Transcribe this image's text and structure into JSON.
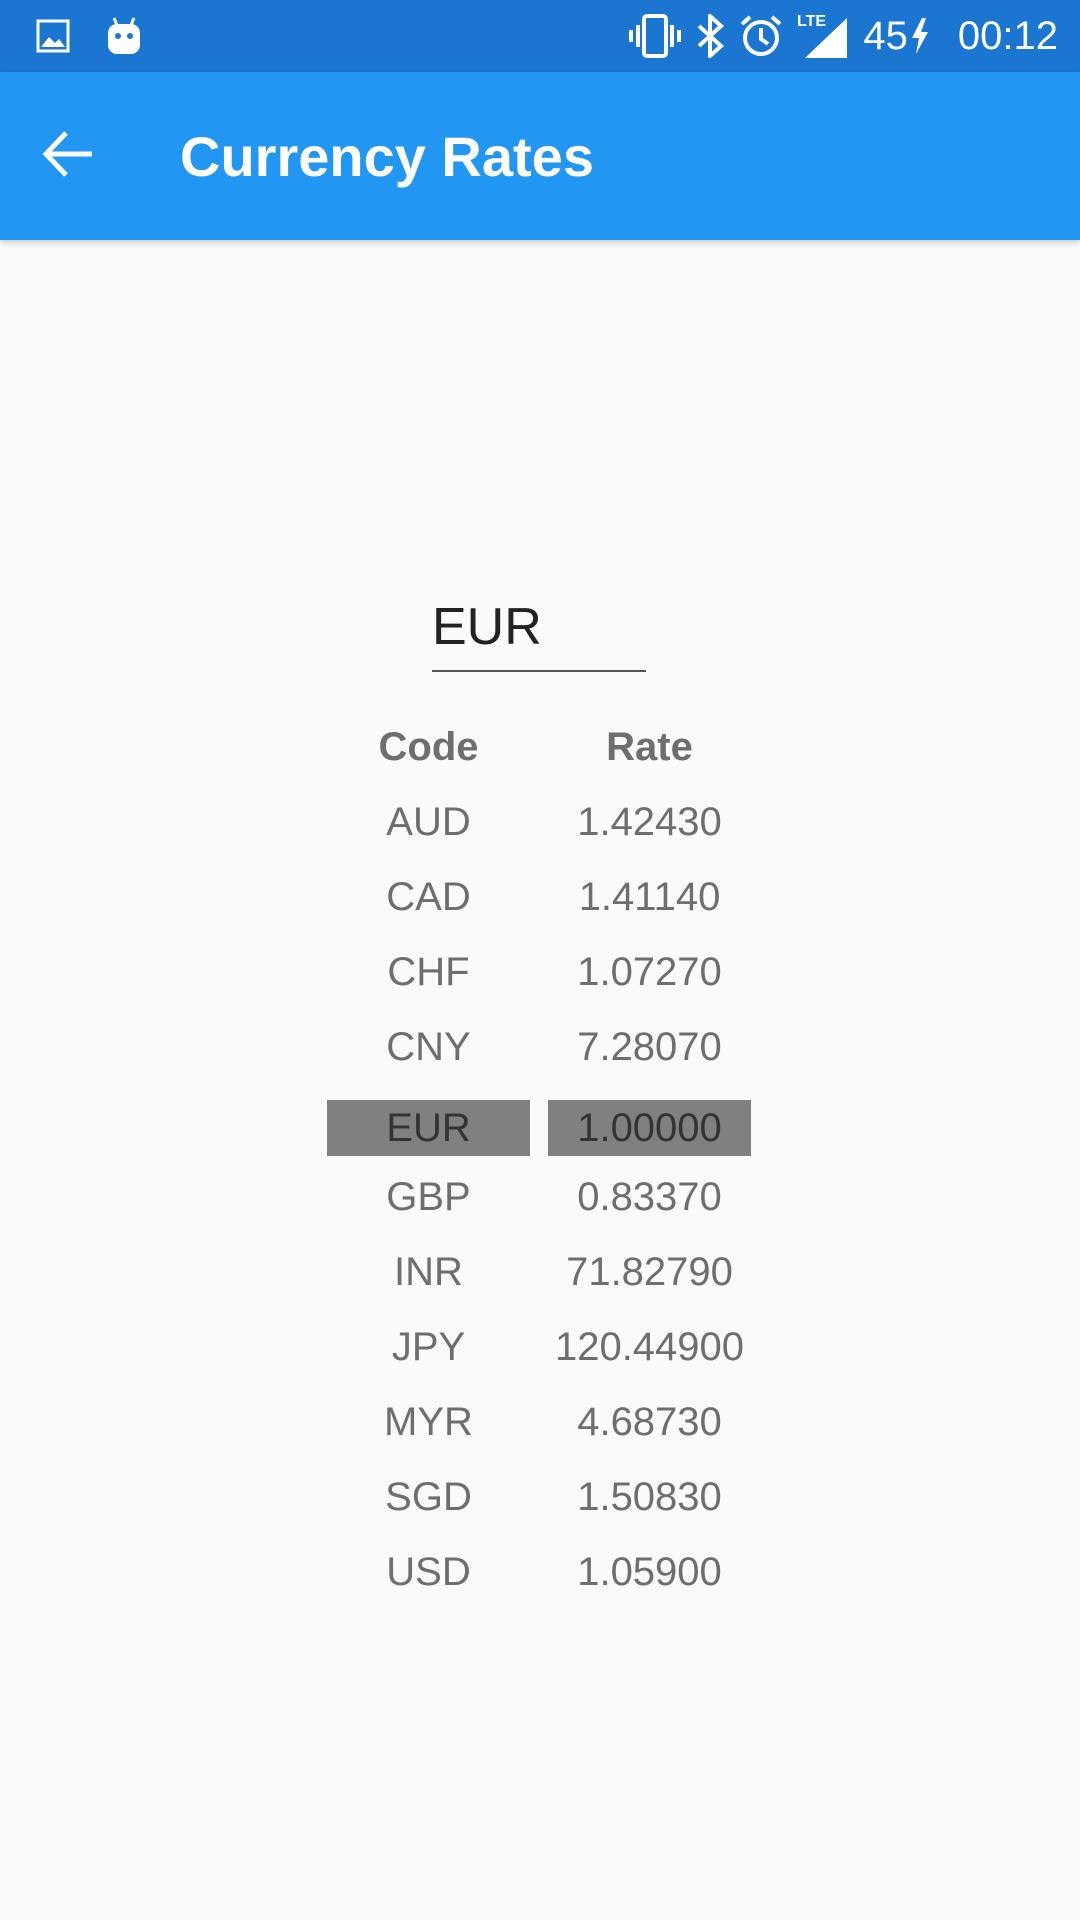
{
  "status_bar": {
    "left_icons": [
      "gallery-icon",
      "android-icon"
    ],
    "right_icons": [
      "vibrate-icon",
      "bluetooth-icon",
      "alarm-icon",
      "lte-signal-icon"
    ],
    "lte_label": "LTE",
    "battery_level": "45",
    "time": "00:12"
  },
  "app_bar": {
    "title": "Currency Rates",
    "back_icon": "arrow-back-icon"
  },
  "base_currency": {
    "value": "EUR"
  },
  "table": {
    "headers": {
      "code": "Code",
      "rate": "Rate"
    },
    "rows": [
      {
        "code": "AUD",
        "rate": "1.42430"
      },
      {
        "code": "CAD",
        "rate": "1.41140"
      },
      {
        "code": "CHF",
        "rate": "1.07270"
      },
      {
        "code": "CNY",
        "rate": "7.28070"
      },
      {
        "code": "EUR",
        "rate": "1.00000"
      },
      {
        "code": "GBP",
        "rate": "0.83370"
      },
      {
        "code": "INR",
        "rate": "71.82790"
      },
      {
        "code": "JPY",
        "rate": "120.44900"
      },
      {
        "code": "MYR",
        "rate": "4.68730"
      },
      {
        "code": "SGD",
        "rate": "1.50830"
      },
      {
        "code": "USD",
        "rate": "1.05900"
      }
    ],
    "selected_code": "EUR"
  },
  "colors": {
    "status_bar": "#1b76d2",
    "app_bar": "#2196f3",
    "background": "#fafafa",
    "selected_row": "#808080",
    "table_text": "#6e6e6e"
  }
}
